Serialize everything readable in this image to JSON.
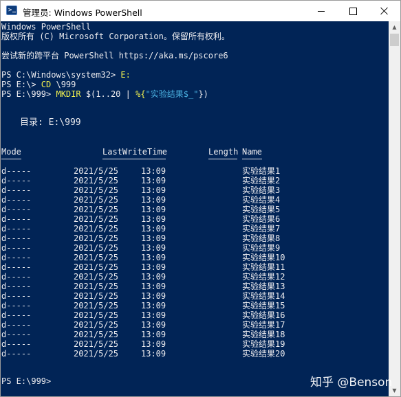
{
  "window": {
    "title": "管理员: Windows PowerShell",
    "icon": "powershell-icon",
    "controls": [
      "minimize-icon",
      "maximize-icon",
      "close-icon"
    ]
  },
  "console": {
    "banner": [
      "Windows PowerShell",
      "版权所有 (C) Microsoft Corporation。保留所有权利。"
    ],
    "hint": "尝试新的跨平台 PowerShell https://aka.ms/pscore6",
    "commands": [
      {
        "prompt": "PS C:\\Windows\\system32> ",
        "parts": [
          {
            "text": "E:",
            "style": "yel"
          }
        ]
      },
      {
        "prompt": "PS E:\\> ",
        "parts": [
          {
            "text": "CD",
            "style": "yel"
          },
          {
            "text": " \\999",
            "style": ""
          }
        ]
      },
      {
        "prompt": "PS E:\\999> ",
        "parts": [
          {
            "text": "MKDIR",
            "style": "yel"
          },
          {
            "text": " $(1..20 | ",
            "style": ""
          },
          {
            "text": "%{",
            "style": "yel"
          },
          {
            "text": "\"实验结果$_\"",
            "style": "str"
          },
          {
            "text": "})",
            "style": ""
          }
        ]
      }
    ],
    "directory_label": "目录: E:\\999",
    "headers": {
      "mode": "Mode",
      "last_write": "LastWriteTime",
      "length": "Length",
      "name": "Name"
    },
    "rows": [
      {
        "mode": "d-----",
        "date": "2021/5/25",
        "time": "13:09",
        "name": "实验结果1"
      },
      {
        "mode": "d-----",
        "date": "2021/5/25",
        "time": "13:09",
        "name": "实验结果2"
      },
      {
        "mode": "d-----",
        "date": "2021/5/25",
        "time": "13:09",
        "name": "实验结果3"
      },
      {
        "mode": "d-----",
        "date": "2021/5/25",
        "time": "13:09",
        "name": "实验结果4"
      },
      {
        "mode": "d-----",
        "date": "2021/5/25",
        "time": "13:09",
        "name": "实验结果5"
      },
      {
        "mode": "d-----",
        "date": "2021/5/25",
        "time": "13:09",
        "name": "实验结果6"
      },
      {
        "mode": "d-----",
        "date": "2021/5/25",
        "time": "13:09",
        "name": "实验结果7"
      },
      {
        "mode": "d-----",
        "date": "2021/5/25",
        "time": "13:09",
        "name": "实验结果8"
      },
      {
        "mode": "d-----",
        "date": "2021/5/25",
        "time": "13:09",
        "name": "实验结果9"
      },
      {
        "mode": "d-----",
        "date": "2021/5/25",
        "time": "13:09",
        "name": "实验结果10"
      },
      {
        "mode": "d-----",
        "date": "2021/5/25",
        "time": "13:09",
        "name": "实验结果11"
      },
      {
        "mode": "d-----",
        "date": "2021/5/25",
        "time": "13:09",
        "name": "实验结果12"
      },
      {
        "mode": "d-----",
        "date": "2021/5/25",
        "time": "13:09",
        "name": "实验结果13"
      },
      {
        "mode": "d-----",
        "date": "2021/5/25",
        "time": "13:09",
        "name": "实验结果14"
      },
      {
        "mode": "d-----",
        "date": "2021/5/25",
        "time": "13:09",
        "name": "实验结果15"
      },
      {
        "mode": "d-----",
        "date": "2021/5/25",
        "time": "13:09",
        "name": "实验结果16"
      },
      {
        "mode": "d-----",
        "date": "2021/5/25",
        "time": "13:09",
        "name": "实验结果17"
      },
      {
        "mode": "d-----",
        "date": "2021/5/25",
        "time": "13:09",
        "name": "实验结果18"
      },
      {
        "mode": "d-----",
        "date": "2021/5/25",
        "time": "13:09",
        "name": "实验结果19"
      },
      {
        "mode": "d-----",
        "date": "2021/5/25",
        "time": "13:09",
        "name": "实验结果20"
      }
    ],
    "final_prompt": "PS E:\\999>"
  },
  "watermark": "知乎 @Benson",
  "colors": {
    "background": "#012456",
    "text": "#eeedf0",
    "command": "#f2f24f",
    "string": "#4ab0e0"
  }
}
